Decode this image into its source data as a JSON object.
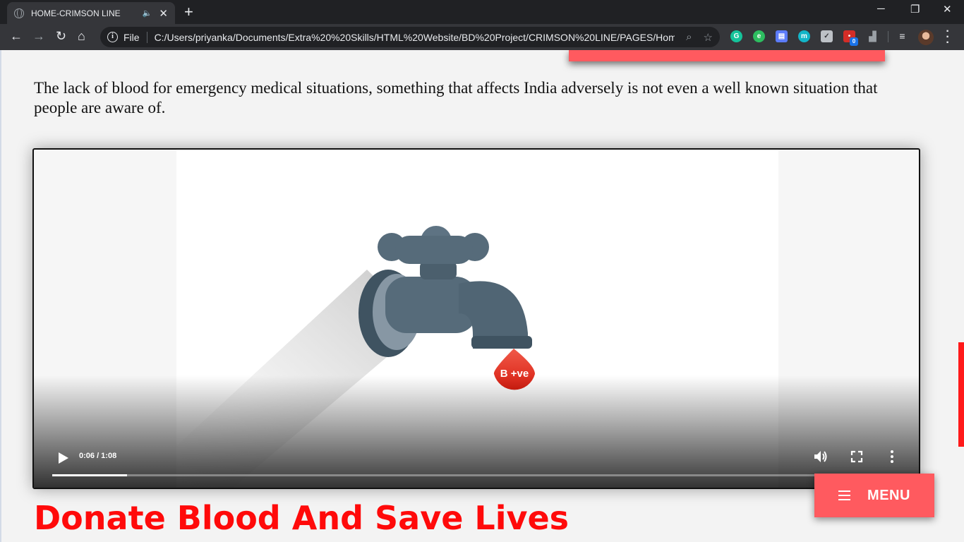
{
  "browser": {
    "tab_title": "HOME-CRIMSON LINE",
    "new_tab_label": "+",
    "window_controls": {
      "minimize": "─",
      "restore": "❐",
      "close": "✕"
    },
    "scheme_label": "File",
    "url": "C:/Users/priyanka/Documents/Extra%20%20Skills/HTML%20Website/BD%20Project/CRIMSON%20LINE/PAGES/Home...",
    "extension_badge": "0",
    "icons": [
      "back-icon",
      "forward-icon",
      "reload-icon",
      "home-icon",
      "info-icon",
      "zoom-icon",
      "star-icon",
      "grammarly-icon",
      "evernote-icon",
      "extension-icon",
      "m-extension-icon",
      "shield-icon",
      "lastpass-icon",
      "chart-icon",
      "media-control-icon",
      "avatar",
      "kebab-menu-icon"
    ]
  },
  "page": {
    "intro": "The lack of blood for emergency medical situations, something that affects India adversely is not even a well known situation that people are aware of.",
    "video": {
      "drop_label": "B +ve",
      "time": "0:06 / 1:08",
      "progress_fraction": 0.088
    },
    "headline": "Donate Blood And Save Lives",
    "menu_label": "MENU",
    "colors": {
      "accent": "#ff5a5f",
      "headline": "#ff0a0a",
      "scroll_indicator": "#ff1a1a"
    }
  }
}
